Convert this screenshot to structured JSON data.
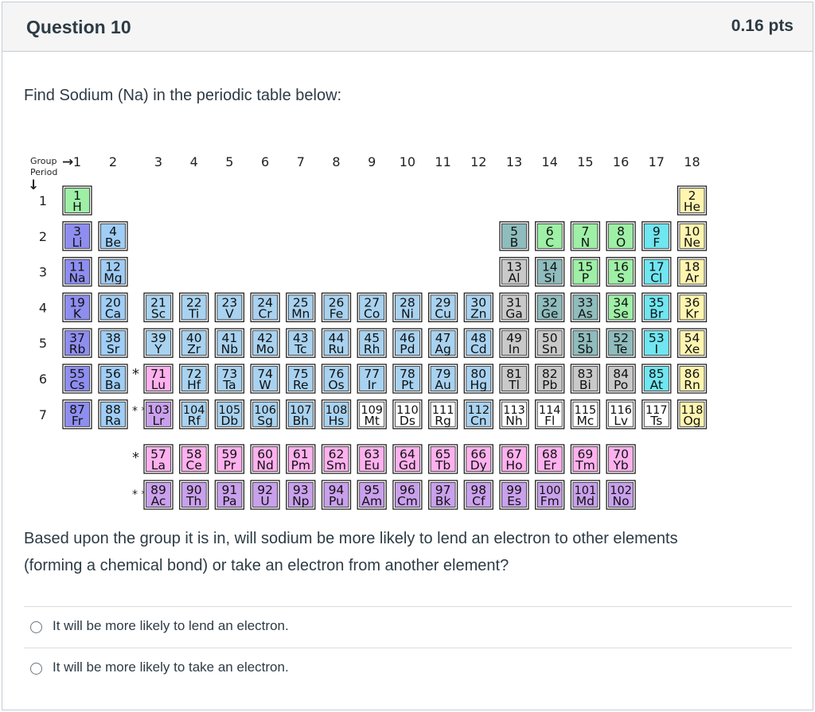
{
  "question": {
    "title": "Question 10",
    "points": "0.16 pts",
    "prompt": "Find Sodium (Na) in the periodic table below:",
    "body_line1": "Based upon the group it is in, will sodium be more likely to lend an electron to other elements",
    "body_line2": "(forming a chemical bond) or take an electron from another element?"
  },
  "answers": [
    {
      "label": "It will be more likely to lend an electron."
    },
    {
      "label": "It will be more likely to take an electron."
    }
  ],
  "periodic_table": {
    "group_label": "Group",
    "period_label": "Period",
    "group_arrow": "→",
    "period_arrow": "↓",
    "f_marker_1": "*",
    "f_marker_2": "* *",
    "groups": [
      "1",
      "2",
      "3",
      "4",
      "5",
      "6",
      "7",
      "8",
      "9",
      "10",
      "11",
      "12",
      "13",
      "14",
      "15",
      "16",
      "17",
      "18"
    ],
    "periods": [
      "1",
      "2",
      "3",
      "4",
      "5",
      "6",
      "7"
    ],
    "colors": {
      "alkali": "#8e8ef0",
      "alkaline_earth": "#9fcdf5",
      "transition": "#a8d2f0",
      "post_transition": "#c9c9c9",
      "metalloid": "#8fbcbc",
      "nonmetal": "#9ef0a6",
      "halogen": "#70e6f0",
      "noble_gas": "#fff5b0",
      "lanthanide": "#ffb0ee",
      "actinide": "#c9a0ec",
      "unknown": "#ffffff"
    },
    "elements": [
      {
        "n": "1",
        "s": "H",
        "g": 1,
        "p": 1,
        "c": "nonmetal"
      },
      {
        "n": "2",
        "s": "He",
        "g": 18,
        "p": 1,
        "c": "noble_gas"
      },
      {
        "n": "3",
        "s": "Li",
        "g": 1,
        "p": 2,
        "c": "alkali"
      },
      {
        "n": "4",
        "s": "Be",
        "g": 2,
        "p": 2,
        "c": "alkaline_earth"
      },
      {
        "n": "5",
        "s": "B",
        "g": 13,
        "p": 2,
        "c": "metalloid"
      },
      {
        "n": "6",
        "s": "C",
        "g": 14,
        "p": 2,
        "c": "nonmetal"
      },
      {
        "n": "7",
        "s": "N",
        "g": 15,
        "p": 2,
        "c": "nonmetal"
      },
      {
        "n": "8",
        "s": "O",
        "g": 16,
        "p": 2,
        "c": "nonmetal"
      },
      {
        "n": "9",
        "s": "F",
        "g": 17,
        "p": 2,
        "c": "halogen"
      },
      {
        "n": "10",
        "s": "Ne",
        "g": 18,
        "p": 2,
        "c": "noble_gas"
      },
      {
        "n": "11",
        "s": "Na",
        "g": 1,
        "p": 3,
        "c": "alkali"
      },
      {
        "n": "12",
        "s": "Mg",
        "g": 2,
        "p": 3,
        "c": "alkaline_earth"
      },
      {
        "n": "13",
        "s": "Al",
        "g": 13,
        "p": 3,
        "c": "post_transition"
      },
      {
        "n": "14",
        "s": "Si",
        "g": 14,
        "p": 3,
        "c": "metalloid"
      },
      {
        "n": "15",
        "s": "P",
        "g": 15,
        "p": 3,
        "c": "nonmetal"
      },
      {
        "n": "16",
        "s": "S",
        "g": 16,
        "p": 3,
        "c": "nonmetal"
      },
      {
        "n": "17",
        "s": "Cl",
        "g": 17,
        "p": 3,
        "c": "halogen"
      },
      {
        "n": "18",
        "s": "Ar",
        "g": 18,
        "p": 3,
        "c": "noble_gas"
      },
      {
        "n": "19",
        "s": "K",
        "g": 1,
        "p": 4,
        "c": "alkali"
      },
      {
        "n": "20",
        "s": "Ca",
        "g": 2,
        "p": 4,
        "c": "alkaline_earth"
      },
      {
        "n": "21",
        "s": "Sc",
        "g": 3,
        "p": 4,
        "c": "transition"
      },
      {
        "n": "22",
        "s": "Ti",
        "g": 4,
        "p": 4,
        "c": "transition"
      },
      {
        "n": "23",
        "s": "V",
        "g": 5,
        "p": 4,
        "c": "transition"
      },
      {
        "n": "24",
        "s": "Cr",
        "g": 6,
        "p": 4,
        "c": "transition"
      },
      {
        "n": "25",
        "s": "Mn",
        "g": 7,
        "p": 4,
        "c": "transition"
      },
      {
        "n": "26",
        "s": "Fe",
        "g": 8,
        "p": 4,
        "c": "transition"
      },
      {
        "n": "27",
        "s": "Co",
        "g": 9,
        "p": 4,
        "c": "transition"
      },
      {
        "n": "28",
        "s": "Ni",
        "g": 10,
        "p": 4,
        "c": "transition"
      },
      {
        "n": "29",
        "s": "Cu",
        "g": 11,
        "p": 4,
        "c": "transition"
      },
      {
        "n": "30",
        "s": "Zn",
        "g": 12,
        "p": 4,
        "c": "transition"
      },
      {
        "n": "31",
        "s": "Ga",
        "g": 13,
        "p": 4,
        "c": "post_transition"
      },
      {
        "n": "32",
        "s": "Ge",
        "g": 14,
        "p": 4,
        "c": "metalloid"
      },
      {
        "n": "33",
        "s": "As",
        "g": 15,
        "p": 4,
        "c": "metalloid"
      },
      {
        "n": "34",
        "s": "Se",
        "g": 16,
        "p": 4,
        "c": "nonmetal"
      },
      {
        "n": "35",
        "s": "Br",
        "g": 17,
        "p": 4,
        "c": "halogen"
      },
      {
        "n": "36",
        "s": "Kr",
        "g": 18,
        "p": 4,
        "c": "noble_gas"
      },
      {
        "n": "37",
        "s": "Rb",
        "g": 1,
        "p": 5,
        "c": "alkali"
      },
      {
        "n": "38",
        "s": "Sr",
        "g": 2,
        "p": 5,
        "c": "alkaline_earth"
      },
      {
        "n": "39",
        "s": "Y",
        "g": 3,
        "p": 5,
        "c": "transition"
      },
      {
        "n": "40",
        "s": "Zr",
        "g": 4,
        "p": 5,
        "c": "transition"
      },
      {
        "n": "41",
        "s": "Nb",
        "g": 5,
        "p": 5,
        "c": "transition"
      },
      {
        "n": "42",
        "s": "Mo",
        "g": 6,
        "p": 5,
        "c": "transition"
      },
      {
        "n": "43",
        "s": "Tc",
        "g": 7,
        "p": 5,
        "c": "transition"
      },
      {
        "n": "44",
        "s": "Ru",
        "g": 8,
        "p": 5,
        "c": "transition"
      },
      {
        "n": "45",
        "s": "Rh",
        "g": 9,
        "p": 5,
        "c": "transition"
      },
      {
        "n": "46",
        "s": "Pd",
        "g": 10,
        "p": 5,
        "c": "transition"
      },
      {
        "n": "47",
        "s": "Ag",
        "g": 11,
        "p": 5,
        "c": "transition"
      },
      {
        "n": "48",
        "s": "Cd",
        "g": 12,
        "p": 5,
        "c": "transition"
      },
      {
        "n": "49",
        "s": "In",
        "g": 13,
        "p": 5,
        "c": "post_transition"
      },
      {
        "n": "50",
        "s": "Sn",
        "g": 14,
        "p": 5,
        "c": "post_transition"
      },
      {
        "n": "51",
        "s": "Sb",
        "g": 15,
        "p": 5,
        "c": "metalloid"
      },
      {
        "n": "52",
        "s": "Te",
        "g": 16,
        "p": 5,
        "c": "metalloid"
      },
      {
        "n": "53",
        "s": "I",
        "g": 17,
        "p": 5,
        "c": "halogen"
      },
      {
        "n": "54",
        "s": "Xe",
        "g": 18,
        "p": 5,
        "c": "noble_gas"
      },
      {
        "n": "55",
        "s": "Cs",
        "g": 1,
        "p": 6,
        "c": "alkali"
      },
      {
        "n": "56",
        "s": "Ba",
        "g": 2,
        "p": 6,
        "c": "alkaline_earth"
      },
      {
        "n": "71",
        "s": "Lu",
        "g": 3,
        "p": 6,
        "c": "lanthanide"
      },
      {
        "n": "72",
        "s": "Hf",
        "g": 4,
        "p": 6,
        "c": "transition"
      },
      {
        "n": "73",
        "s": "Ta",
        "g": 5,
        "p": 6,
        "c": "transition"
      },
      {
        "n": "74",
        "s": "W",
        "g": 6,
        "p": 6,
        "c": "transition"
      },
      {
        "n": "75",
        "s": "Re",
        "g": 7,
        "p": 6,
        "c": "transition"
      },
      {
        "n": "76",
        "s": "Os",
        "g": 8,
        "p": 6,
        "c": "transition"
      },
      {
        "n": "77",
        "s": "Ir",
        "g": 9,
        "p": 6,
        "c": "transition"
      },
      {
        "n": "78",
        "s": "Pt",
        "g": 10,
        "p": 6,
        "c": "transition"
      },
      {
        "n": "79",
        "s": "Au",
        "g": 11,
        "p": 6,
        "c": "transition"
      },
      {
        "n": "80",
        "s": "Hg",
        "g": 12,
        "p": 6,
        "c": "transition"
      },
      {
        "n": "81",
        "s": "Tl",
        "g": 13,
        "p": 6,
        "c": "post_transition"
      },
      {
        "n": "82",
        "s": "Pb",
        "g": 14,
        "p": 6,
        "c": "post_transition"
      },
      {
        "n": "83",
        "s": "Bi",
        "g": 15,
        "p": 6,
        "c": "post_transition"
      },
      {
        "n": "84",
        "s": "Po",
        "g": 16,
        "p": 6,
        "c": "post_transition"
      },
      {
        "n": "85",
        "s": "At",
        "g": 17,
        "p": 6,
        "c": "halogen"
      },
      {
        "n": "86",
        "s": "Rn",
        "g": 18,
        "p": 6,
        "c": "noble_gas"
      },
      {
        "n": "87",
        "s": "Fr",
        "g": 1,
        "p": 7,
        "c": "alkali"
      },
      {
        "n": "88",
        "s": "Ra",
        "g": 2,
        "p": 7,
        "c": "alkaline_earth"
      },
      {
        "n": "103",
        "s": "Lr",
        "g": 3,
        "p": 7,
        "c": "actinide"
      },
      {
        "n": "104",
        "s": "Rf",
        "g": 4,
        "p": 7,
        "c": "transition"
      },
      {
        "n": "105",
        "s": "Db",
        "g": 5,
        "p": 7,
        "c": "transition"
      },
      {
        "n": "106",
        "s": "Sg",
        "g": 6,
        "p": 7,
        "c": "transition"
      },
      {
        "n": "107",
        "s": "Bh",
        "g": 7,
        "p": 7,
        "c": "transition"
      },
      {
        "n": "108",
        "s": "Hs",
        "g": 8,
        "p": 7,
        "c": "transition"
      },
      {
        "n": "109",
        "s": "Mt",
        "g": 9,
        "p": 7,
        "c": "unknown"
      },
      {
        "n": "110",
        "s": "Ds",
        "g": 10,
        "p": 7,
        "c": "unknown"
      },
      {
        "n": "111",
        "s": "Rg",
        "g": 11,
        "p": 7,
        "c": "unknown"
      },
      {
        "n": "112",
        "s": "Cn",
        "g": 12,
        "p": 7,
        "c": "transition"
      },
      {
        "n": "113",
        "s": "Nh",
        "g": 13,
        "p": 7,
        "c": "unknown"
      },
      {
        "n": "114",
        "s": "Fl",
        "g": 14,
        "p": 7,
        "c": "unknown"
      },
      {
        "n": "115",
        "s": "Mc",
        "g": 15,
        "p": 7,
        "c": "unknown"
      },
      {
        "n": "116",
        "s": "Lv",
        "g": 16,
        "p": 7,
        "c": "unknown"
      },
      {
        "n": "117",
        "s": "Ts",
        "g": 17,
        "p": 7,
        "c": "unknown"
      },
      {
        "n": "118",
        "s": "Og",
        "g": 18,
        "p": 7,
        "c": "noble_gas"
      },
      {
        "n": "57",
        "s": "La",
        "g": 3,
        "p": 8,
        "c": "lanthanide"
      },
      {
        "n": "58",
        "s": "Ce",
        "g": 4,
        "p": 8,
        "c": "lanthanide"
      },
      {
        "n": "59",
        "s": "Pr",
        "g": 5,
        "p": 8,
        "c": "lanthanide"
      },
      {
        "n": "60",
        "s": "Nd",
        "g": 6,
        "p": 8,
        "c": "lanthanide"
      },
      {
        "n": "61",
        "s": "Pm",
        "g": 7,
        "p": 8,
        "c": "lanthanide"
      },
      {
        "n": "62",
        "s": "Sm",
        "g": 8,
        "p": 8,
        "c": "lanthanide"
      },
      {
        "n": "63",
        "s": "Eu",
        "g": 9,
        "p": 8,
        "c": "lanthanide"
      },
      {
        "n": "64",
        "s": "Gd",
        "g": 10,
        "p": 8,
        "c": "lanthanide"
      },
      {
        "n": "65",
        "s": "Tb",
        "g": 11,
        "p": 8,
        "c": "lanthanide"
      },
      {
        "n": "66",
        "s": "Dy",
        "g": 12,
        "p": 8,
        "c": "lanthanide"
      },
      {
        "n": "67",
        "s": "Ho",
        "g": 13,
        "p": 8,
        "c": "lanthanide"
      },
      {
        "n": "68",
        "s": "Er",
        "g": 14,
        "p": 8,
        "c": "lanthanide"
      },
      {
        "n": "69",
        "s": "Tm",
        "g": 15,
        "p": 8,
        "c": "lanthanide"
      },
      {
        "n": "70",
        "s": "Yb",
        "g": 16,
        "p": 8,
        "c": "lanthanide"
      },
      {
        "n": "89",
        "s": "Ac",
        "g": 3,
        "p": 9,
        "c": "actinide"
      },
      {
        "n": "90",
        "s": "Th",
        "g": 4,
        "p": 9,
        "c": "actinide"
      },
      {
        "n": "91",
        "s": "Pa",
        "g": 5,
        "p": 9,
        "c": "actinide"
      },
      {
        "n": "92",
        "s": "U",
        "g": 6,
        "p": 9,
        "c": "actinide"
      },
      {
        "n": "93",
        "s": "Np",
        "g": 7,
        "p": 9,
        "c": "actinide"
      },
      {
        "n": "94",
        "s": "Pu",
        "g": 8,
        "p": 9,
        "c": "actinide"
      },
      {
        "n": "95",
        "s": "Am",
        "g": 9,
        "p": 9,
        "c": "actinide"
      },
      {
        "n": "96",
        "s": "Cm",
        "g": 10,
        "p": 9,
        "c": "actinide"
      },
      {
        "n": "97",
        "s": "Bk",
        "g": 11,
        "p": 9,
        "c": "actinide"
      },
      {
        "n": "98",
        "s": "Cf",
        "g": 12,
        "p": 9,
        "c": "actinide"
      },
      {
        "n": "99",
        "s": "Es",
        "g": 13,
        "p": 9,
        "c": "actinide"
      },
      {
        "n": "100",
        "s": "Fm",
        "g": 14,
        "p": 9,
        "c": "actinide"
      },
      {
        "n": "101",
        "s": "Md",
        "g": 15,
        "p": 9,
        "c": "actinide"
      },
      {
        "n": "102",
        "s": "No",
        "g": 16,
        "p": 9,
        "c": "actinide"
      }
    ]
  }
}
